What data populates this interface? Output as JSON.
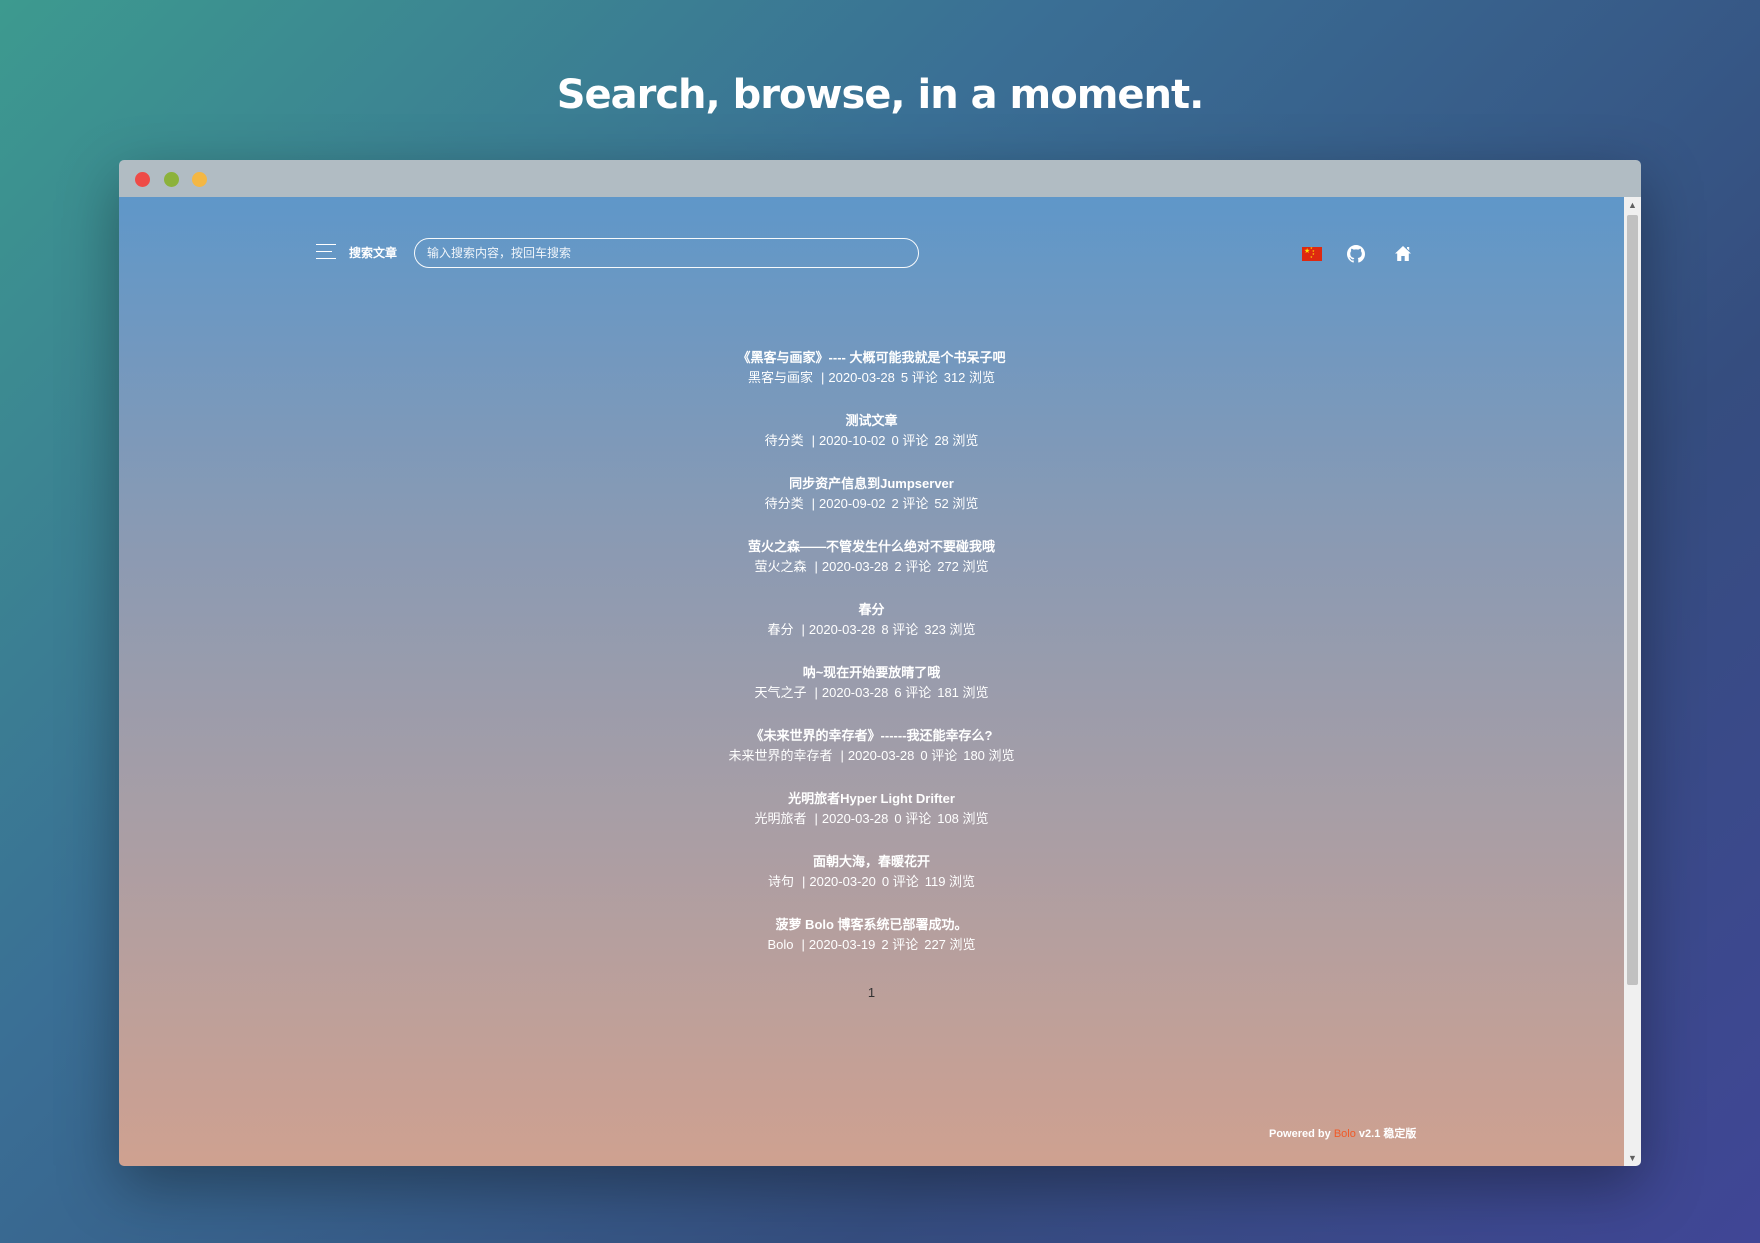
{
  "headline": "Search, browse, in a moment.",
  "window": {
    "dots": {
      "close": "#ee4b47",
      "minimize": "#8cb23b",
      "maximize": "#f4b744"
    }
  },
  "header": {
    "search_label": "搜索文章",
    "search_placeholder": "输入搜索内容，按回车搜索",
    "icons": [
      "menu-icon",
      "china-flag-icon",
      "github-icon",
      "home-icon"
    ]
  },
  "posts": [
    {
      "title": "《黑客与画家》---- 大概可能我就是个书呆子吧",
      "category": "黑客与画家",
      "date": "2020-03-28",
      "comments": "5 评论",
      "views": "312 浏览"
    },
    {
      "title": "测试文章",
      "category": "待分类",
      "date": "2020-10-02",
      "comments": "0 评论",
      "views": "28 浏览"
    },
    {
      "title": "同步资产信息到Jumpserver",
      "category": "待分类",
      "date": "2020-09-02",
      "comments": "2 评论",
      "views": "52 浏览"
    },
    {
      "title": "萤火之森——不管发生什么绝对不要碰我哦",
      "category": "萤火之森",
      "date": "2020-03-28",
      "comments": "2 评论",
      "views": "272 浏览"
    },
    {
      "title": "春分",
      "category": "春分",
      "date": "2020-03-28",
      "comments": "8 评论",
      "views": "323 浏览"
    },
    {
      "title": "呐~现在开始要放晴了哦",
      "category": "天气之子",
      "date": "2020-03-28",
      "comments": "6 评论",
      "views": "181 浏览"
    },
    {
      "title": "《未来世界的幸存者》------我还能幸存么?",
      "category": "未来世界的幸存者",
      "date": "2020-03-28",
      "comments": "0 评论",
      "views": "180 浏览"
    },
    {
      "title": "光明旅者Hyper Light Drifter",
      "category": "光明旅者",
      "date": "2020-03-28",
      "comments": "0 评论",
      "views": "108 浏览"
    },
    {
      "title": "面朝大海，春暖花开",
      "category": "诗句",
      "date": "2020-03-20",
      "comments": "0 评论",
      "views": "119 浏览"
    },
    {
      "title": "菠萝 Bolo 博客系统已部署成功。",
      "category": "Bolo",
      "date": "2020-03-19",
      "comments": "2 评论",
      "views": "227 浏览"
    }
  ],
  "pagination": {
    "current_page": "1"
  },
  "footer": {
    "powered_by": "Powered by",
    "brand": "Bolo",
    "version": "v2.1 稳定版"
  },
  "colors": {
    "brand_accent": "#f05a28",
    "text": "#ffffff"
  }
}
